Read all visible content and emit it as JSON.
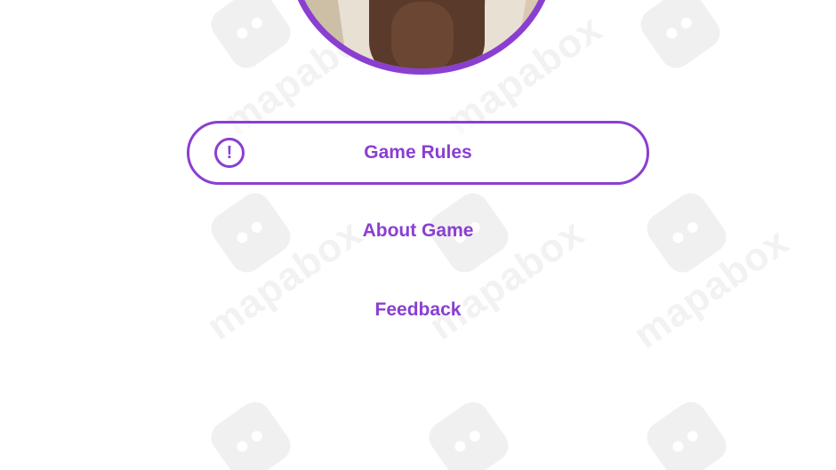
{
  "menu": {
    "game_rules": {
      "label": "Game Rules",
      "icon": "exclamation-circle-icon"
    },
    "about_game": {
      "label": "About Game"
    },
    "feedback": {
      "label": "Feedback"
    }
  },
  "watermark": {
    "text": "mapabox"
  },
  "colors": {
    "accent": "#8a3fd1",
    "background": "#ffffff"
  }
}
